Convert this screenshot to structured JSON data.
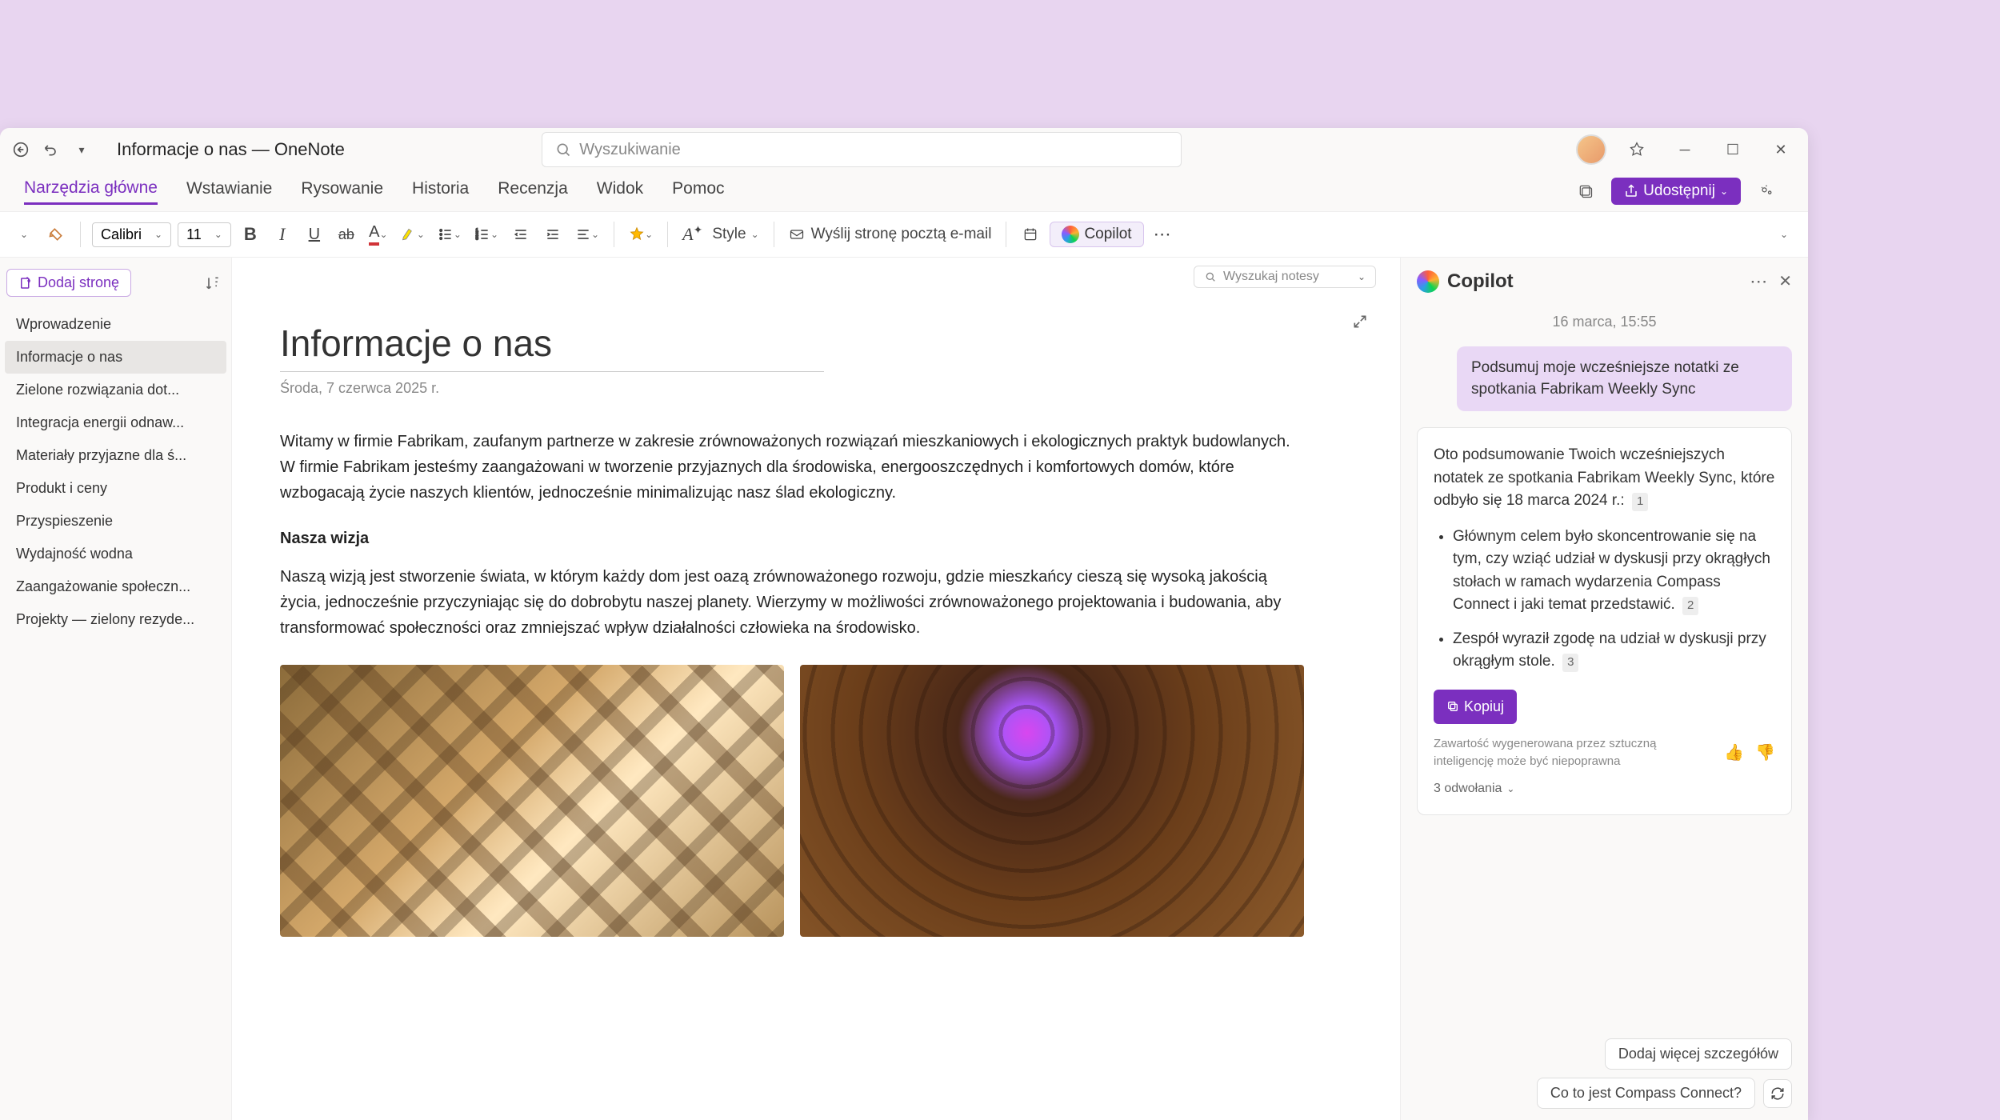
{
  "titlebar": {
    "title": "Informacje o nas — OneNote",
    "search_placeholder": "Wyszukiwanie"
  },
  "ribbon": {
    "tabs": [
      "Narzędzia główne",
      "Wstawianie",
      "Rysowanie",
      "Historia",
      "Recenzja",
      "Widok",
      "Pomoc"
    ],
    "active_index": 0,
    "share_label": "Udostępnij"
  },
  "toolbar": {
    "font_name": "Calibri",
    "font_size": "11",
    "style_label": "Style",
    "email_label": "Wyślij stronę pocztą e-mail",
    "copilot_label": "Copilot"
  },
  "sidebar": {
    "add_page_label": "Dodaj stronę",
    "pages": [
      "Wprowadzenie",
      "Informacje o nas",
      "Zielone rozwiązania dot...",
      "Integracja energii odnaw...",
      "Materiały przyjazne dla ś...",
      "Produkt i ceny",
      "Przyspieszenie",
      "Wydajność wodna",
      "Zaangażowanie społeczn...",
      "Projekty — zielony rezyde..."
    ],
    "active_index": 1,
    "search_notebooks_placeholder": "Wyszukaj notesy"
  },
  "document": {
    "title": "Informacje o nas",
    "date": "Środa, 7 czerwca 2025 r.",
    "para1": "Witamy w firmie Fabrikam, zaufanym partnerze w zakresie zrównoważonych rozwiązań mieszkaniowych i ekologicznych praktyk budowlanych. W firmie Fabrikam jesteśmy zaangażowani w tworzenie przyjaznych dla środowiska, energooszczędnych i komfortowych domów, które wzbogacają życie naszych klientów, jednocześnie minimalizując nasz ślad ekologiczny.",
    "heading1": "Nasza wizja",
    "para2": "Naszą wizją jest stworzenie świata, w którym każdy dom jest oazą zrównoważonego rozwoju, gdzie mieszkańcy cieszą się wysoką jakością życia, jednocześnie przyczyniając się do dobrobytu naszej planety. Wierzymy w możliwości zrównoważonego projektowania i budowania, aby transformować społeczności oraz zmniejszać wpływ działalności człowieka na środowisko."
  },
  "copilot": {
    "title": "Copilot",
    "timestamp": "16 marca, 15:55",
    "user_message": "Podsumuj moje wcześniejsze notatki ze spotkania Fabrikam Weekly Sync",
    "ai_intro": "Oto podsumowanie Twoich wcześniejszych notatek ze spotkania Fabrikam Weekly Sync, które odbyło się 18 marca 2024 r.:",
    "bullets": [
      "Głównym celem było skoncentrowanie się na tym, czy wziąć udział w dyskusji przy okrągłych stołach w ramach wydarzenia Compass Connect i jaki temat przedstawić.",
      "Zespół wyraził zgodę na udział w dyskusji przy okrągłym stole."
    ],
    "bullet_refs": [
      "2",
      "3"
    ],
    "intro_ref": "1",
    "copy_label": "Kopiuj",
    "disclaimer": "Zawartość wygenerowana przez sztuczną inteligencję może być niepoprawna",
    "references_label": "3 odwołania",
    "suggestions": [
      "Dodaj więcej szczegółów",
      "Co to jest Compass Connect?"
    ]
  }
}
